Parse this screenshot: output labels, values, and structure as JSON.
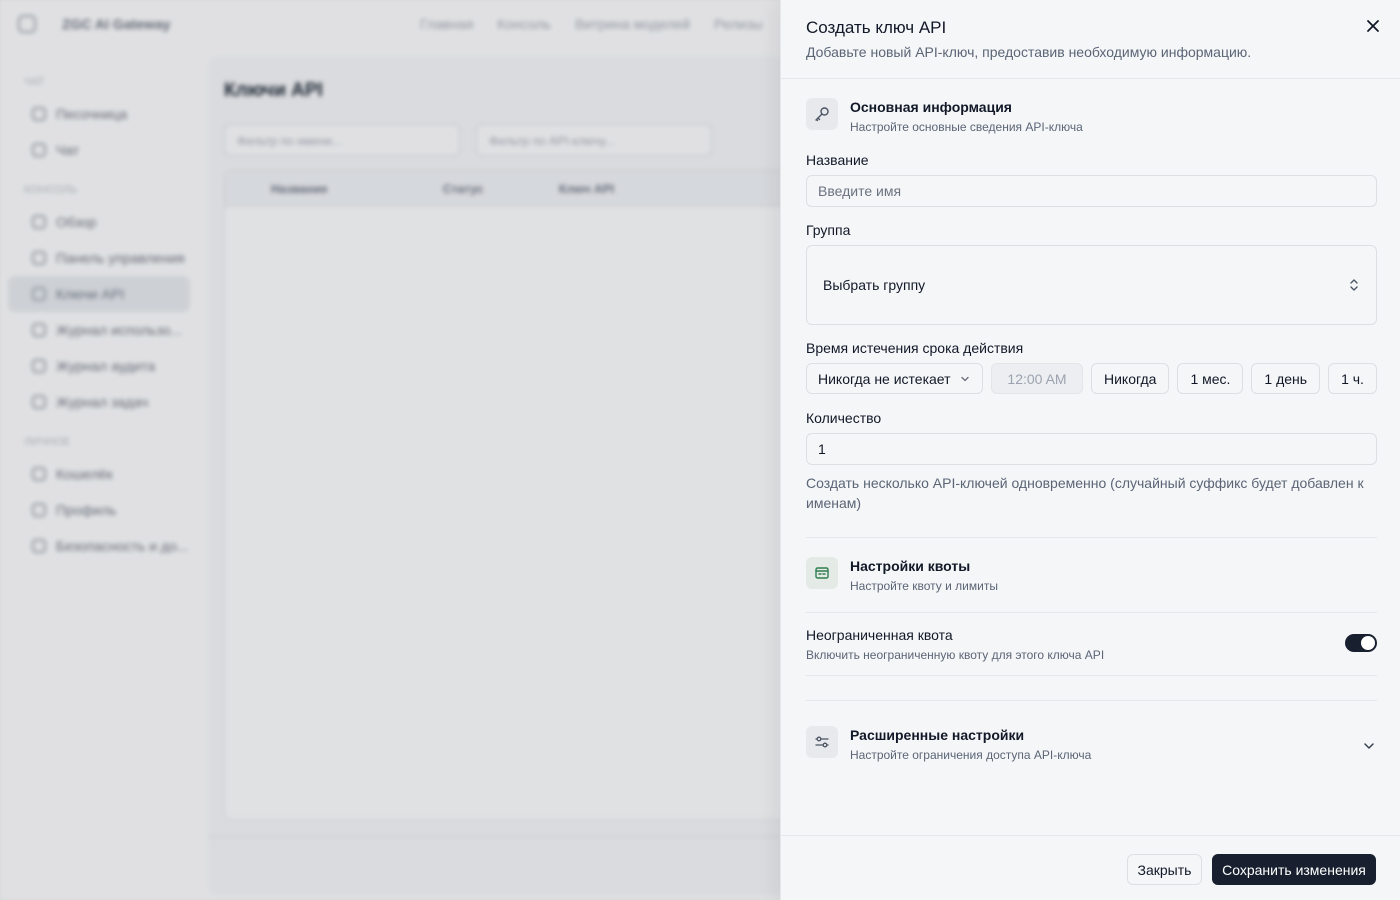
{
  "background": {
    "brand": "ZGC AI Gateway",
    "nav": [
      "Главная",
      "Консоль",
      "Витрина моделей",
      "Релизы"
    ],
    "sidebar": [
      {
        "section": "ЧАТ",
        "items": [
          "Песочница",
          "Чат"
        ]
      },
      {
        "section": "КОНСОЛЬ",
        "items": [
          "Обзор",
          "Панель управления",
          "Ключи API",
          "Журнал использо...",
          "Журнал аудита",
          "Журнал задач"
        ]
      },
      {
        "section": "ЛИЧНОЕ",
        "items": [
          "Кошелёк",
          "Профиль",
          "Безопасность и до..."
        ]
      }
    ],
    "page_title": "Ключи API",
    "filters": [
      "Фильтр по имени...",
      "Фильтр по API-ключу..."
    ],
    "table_headers": [
      "Название",
      "Статус",
      "Ключ API"
    ]
  },
  "drawer": {
    "title": "Создать ключ API",
    "description": "Добавьте новый API-ключ, предоставив необходимую информацию.",
    "basic": {
      "title": "Основная информация",
      "subtitle": "Настройте основные сведения API-ключа",
      "name_label": "Название",
      "name_placeholder": "Введите имя",
      "name_value": "",
      "group_label": "Группа",
      "group_value": "Выбрать группу",
      "expiry_label": "Время истечения срока действия",
      "expiry_select": "Никогда не истекает",
      "expiry_time": "12:00 AM",
      "expiry_presets": [
        "Никогда",
        "1 мес.",
        "1 день",
        "1 ч."
      ],
      "quantity_label": "Количество",
      "quantity_value": "1",
      "quantity_help": "Создать несколько API-ключей одновременно (случайный суффикс будет добавлен к именам)"
    },
    "quota": {
      "title": "Настройки квоты",
      "subtitle": "Настройте квоту и лимиты",
      "unlimited_label": "Неограниченная квота",
      "unlimited_help": "Включить неограниченную квоту для этого ключа API",
      "unlimited_enabled": true
    },
    "advanced": {
      "title": "Расширенные настройки",
      "subtitle": "Настройте ограничения доступа API-ключа",
      "expanded": false
    },
    "buttons": {
      "close": "Закрыть",
      "save": "Сохранить изменения"
    }
  },
  "icons": {
    "close": "close-icon",
    "basic": "key-icon",
    "quota": "wallet-icon",
    "advanced": "sliders-icon"
  },
  "colors": {
    "primary": "#18202f",
    "drawer_bg": "#f5f6f8",
    "muted_text": "#5b6576",
    "quota_icon": "#2f7d4f"
  }
}
